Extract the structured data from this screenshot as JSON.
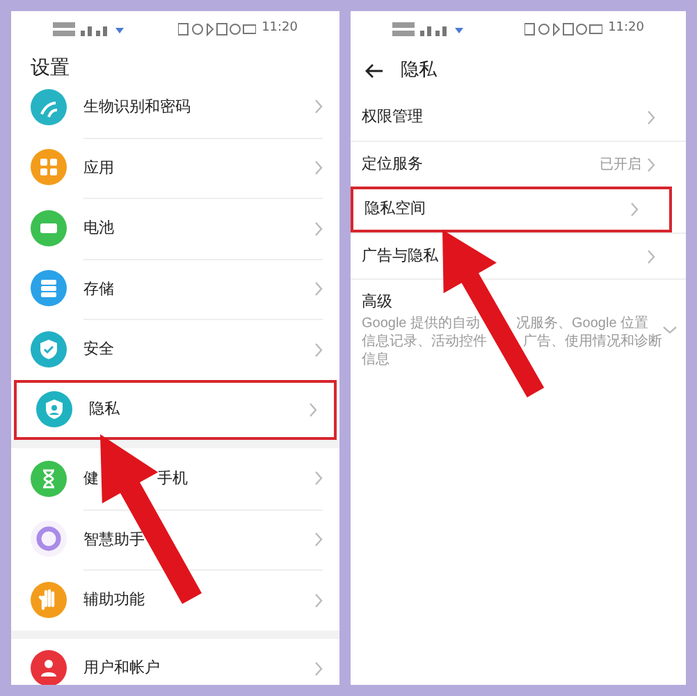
{
  "left": {
    "status_bar": {
      "time": "11:20"
    },
    "title": "设置",
    "groups": [
      {
        "items": [
          {
            "kind": "fingerprint",
            "label": "生物识别和密码",
            "color": "#27b3c3",
            "highlighted": false
          },
          {
            "kind": "apps",
            "label": "应用",
            "color": "#f39c1b",
            "highlighted": false
          },
          {
            "kind": "battery",
            "label": "电池",
            "color": "#3cc051",
            "highlighted": false
          },
          {
            "kind": "storage",
            "label": "存储",
            "color": "#2aa2e8",
            "highlighted": false
          },
          {
            "kind": "security",
            "label": "安全",
            "color": "#22b0c4",
            "highlighted": false
          },
          {
            "kind": "privacy",
            "label": "隐私",
            "color": "#1fb2c0",
            "highlighted": true
          }
        ]
      },
      {
        "items": [
          {
            "kind": "hourglass",
            "label": "健",
            "label_after": "手机",
            "color": "#3cc051",
            "highlighted": false
          },
          {
            "kind": "ring",
            "label": "智慧助手",
            "color": "#a98be8",
            "highlighted": false
          },
          {
            "kind": "hand",
            "label": "辅助功能",
            "color": "#f39c1b",
            "highlighted": false
          }
        ]
      },
      {
        "items": [
          {
            "kind": "user",
            "label": "用户和帐户",
            "color": "#e8333b",
            "highlighted": false
          }
        ]
      }
    ]
  },
  "right": {
    "status_bar": {
      "time": "11:20"
    },
    "title": "隐私",
    "items": [
      {
        "kind": "link",
        "label": "权限管理",
        "highlighted": false
      },
      {
        "kind": "link",
        "label": "定位服务",
        "value": "已开启",
        "highlighted": false
      },
      {
        "kind": "link",
        "label": "隐私空间",
        "highlighted": true
      },
      {
        "kind": "link",
        "label": "广告与隐私",
        "highlighted": false
      },
      {
        "kind": "expandable",
        "label": "高级",
        "expanded": false,
        "description": [
          [
            "Google 提供的自动",
            "况服务、Google 位置"
          ],
          [
            "信息记录、活动控件",
            "广告、使用情况和诊断"
          ],
          [
            "信息"
          ]
        ]
      }
    ]
  }
}
